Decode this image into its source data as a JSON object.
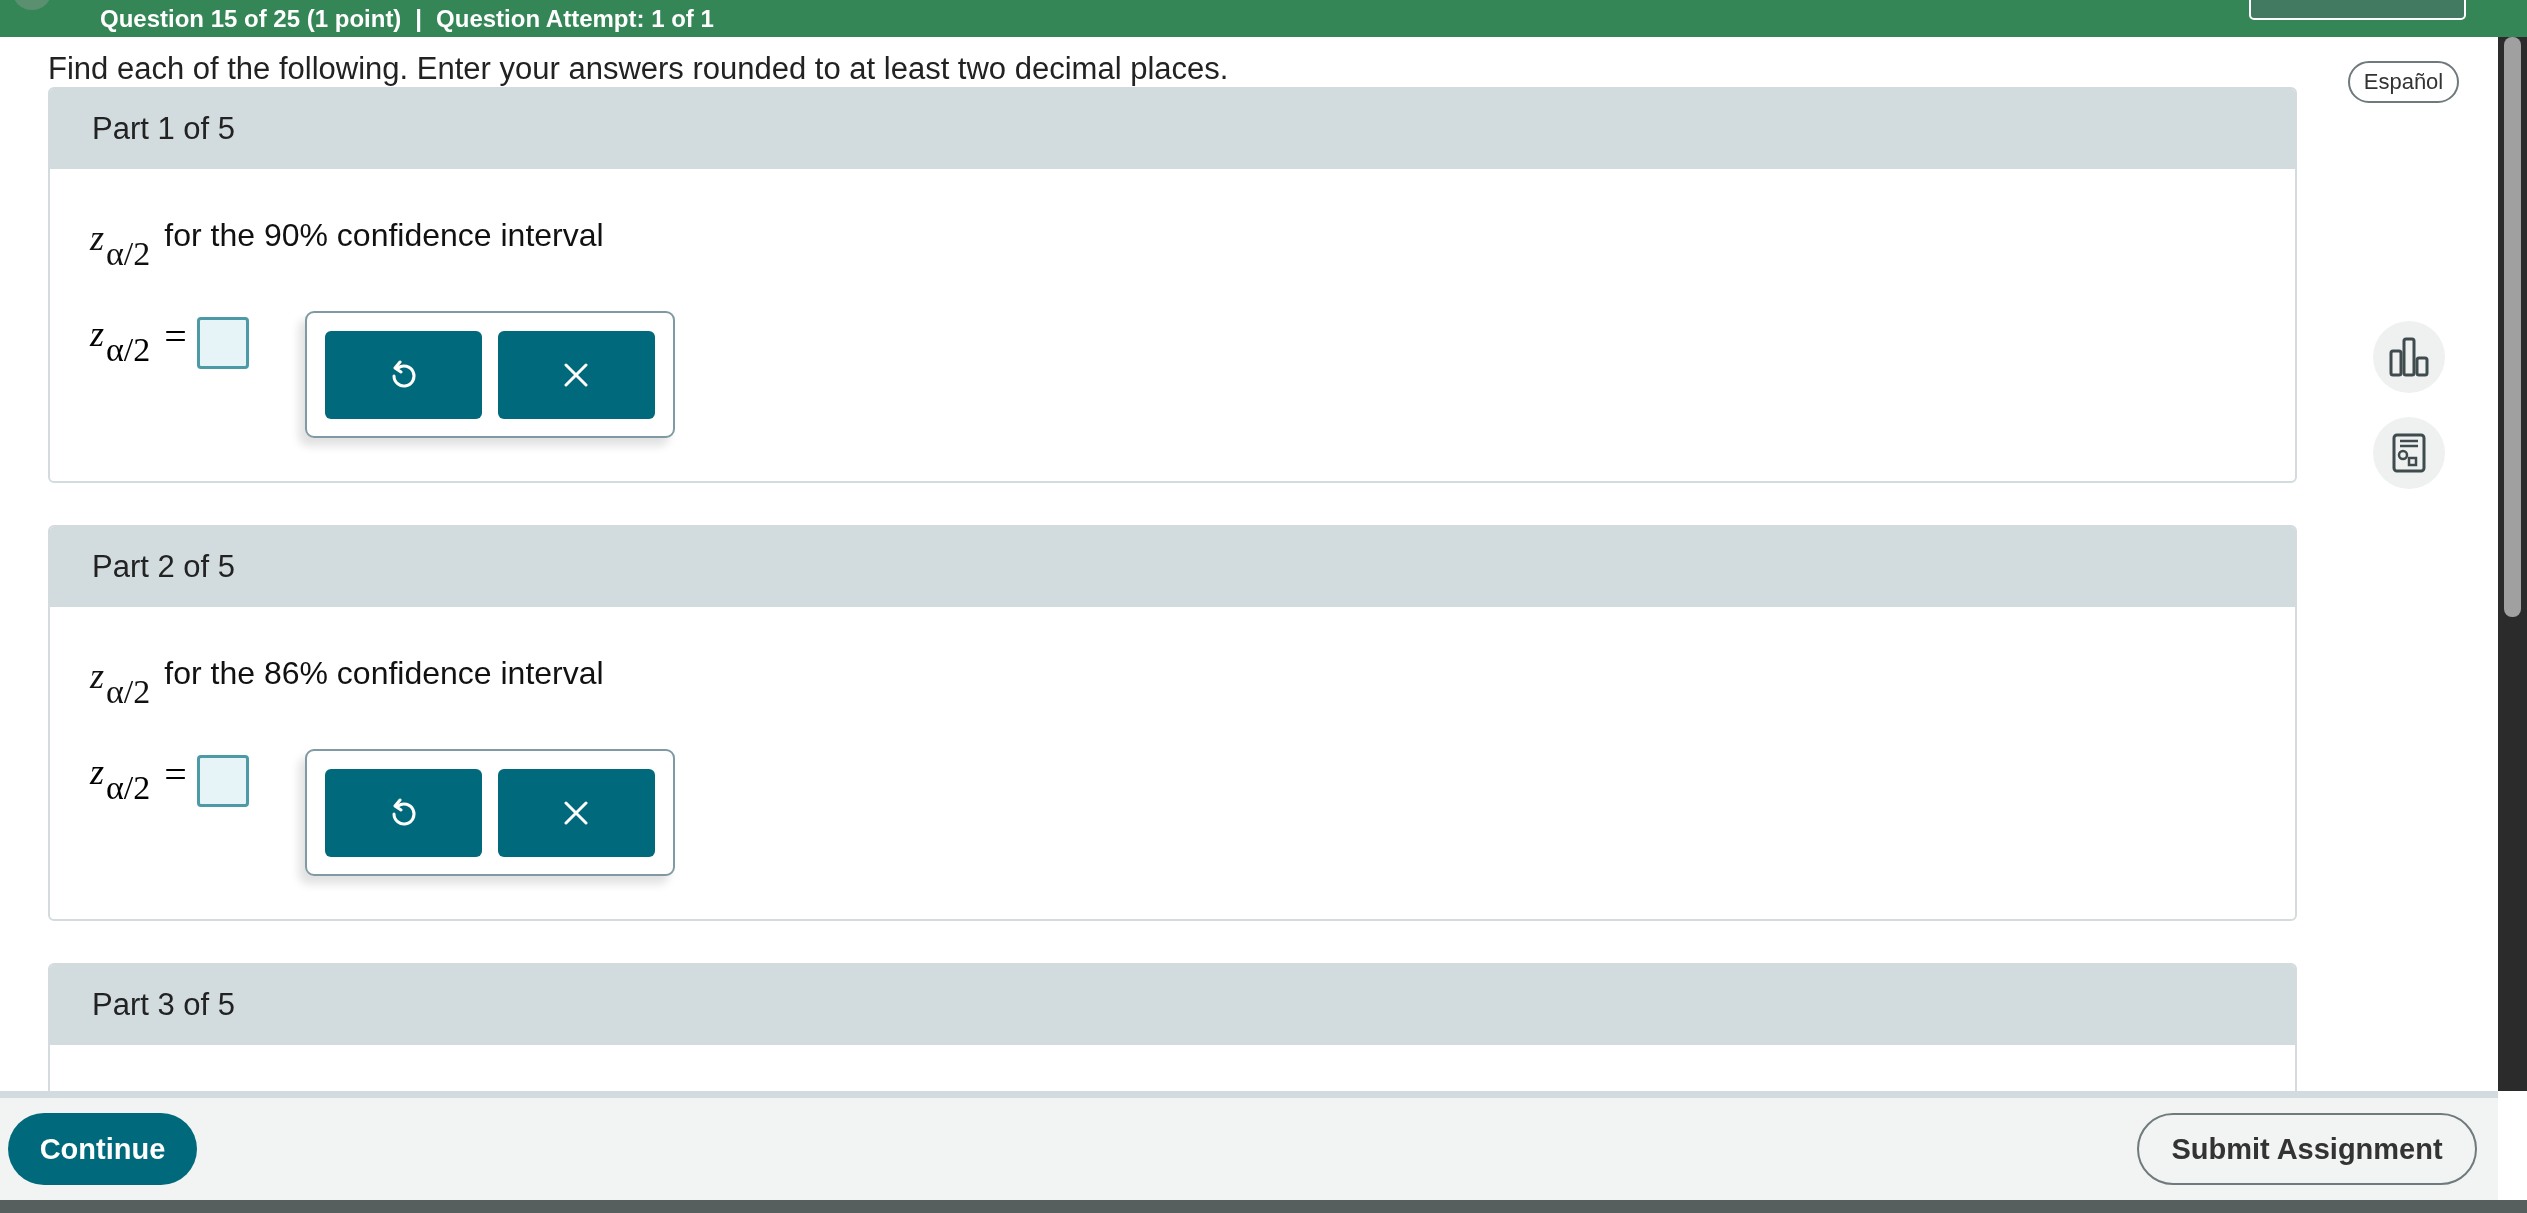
{
  "header": {
    "title": "Question 15 of 25 (1 point)",
    "separator": "|",
    "attempt": "Question Attempt: 1 of 1"
  },
  "instruction": "Find each of the following. Enter your answers rounded to at least two decimal places.",
  "language_button": "Español",
  "parts": [
    {
      "label": "Part 1 of 5",
      "prompt_symbol": "z",
      "prompt_subscript": "α/2",
      "prompt": "for the 90% confidence interval",
      "answer_symbol": "z",
      "answer_subscript": "α/2",
      "answer_label": "="
    },
    {
      "label": "Part 2 of 5",
      "prompt_symbol": "z",
      "prompt_subscript": "α/2",
      "prompt": "for the 86% confidence interval",
      "answer_symbol": "z",
      "answer_subscript": "α/2",
      "answer_label": "="
    },
    {
      "label": "Part 3 of 5"
    }
  ],
  "footer": {
    "continue": "Continue",
    "submit": "Submit Assignment"
  }
}
